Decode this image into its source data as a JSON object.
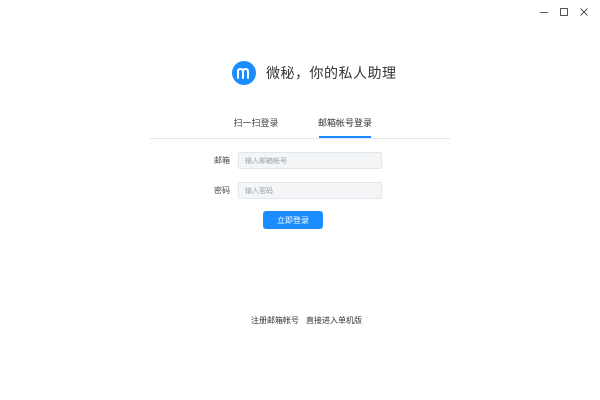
{
  "window": {
    "minimize_icon": "minimize-icon",
    "maximize_icon": "maximize-icon",
    "close_icon": "close-icon"
  },
  "brand": {
    "logo_icon": "m-logo-icon",
    "title": "微秘，你的私人助理",
    "accent": "#1a8cff"
  },
  "tabs": [
    {
      "label": "扫一扫登录",
      "active": false
    },
    {
      "label": "邮箱帐号登录",
      "active": true
    }
  ],
  "form": {
    "email_label": "邮箱",
    "email_placeholder": "输入邮箱帐号",
    "password_label": "密码",
    "password_placeholder": "输入密码",
    "submit_label": "立即登录"
  },
  "footer": {
    "register_label": "注册邮箱帐号",
    "offline_label": "直接进入单机版"
  }
}
